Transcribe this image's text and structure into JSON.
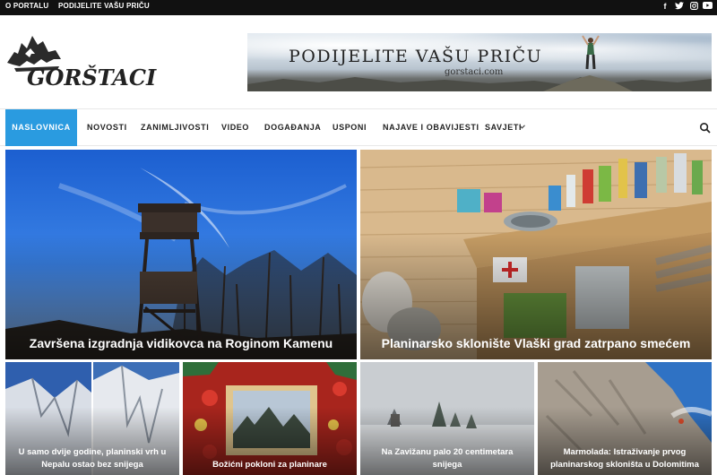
{
  "topbar": {
    "links": [
      "O PORTALU",
      "PODIJELITE VAŠU PRIČU"
    ],
    "social": [
      "f",
      "t",
      "ig",
      "yt"
    ]
  },
  "logo": {
    "text": "GORŠTACI"
  },
  "banner": {
    "title": "PODIJELITE VAŠU PRIČU",
    "subtitle": "gorstaci.com"
  },
  "nav": {
    "items": [
      "NASLOVNICA",
      "NOVOSTI",
      "ZANIMLJIVOSTI",
      "VIDEO",
      "DOGAĐANJA",
      "USPONI",
      "NAJAVE I OBAVIJESTI",
      "SAVJETI"
    ],
    "active_index": 0,
    "dropdown_icon": "chevron-down-icon",
    "search_icon": "search-icon"
  },
  "featured": [
    {
      "title": "Završena izgradnja vidikovca na Roginom Kamenu"
    },
    {
      "title": "Planinarsko sklonište Vlaški grad zatrpano smećem"
    }
  ],
  "articles": [
    {
      "title": "U samo dvije godine, planinski vrh u Nepalu ostao bez snijega"
    },
    {
      "title": "Božićni pokloni za planinare"
    },
    {
      "title": "Na Zavižanu palo 20 centimetara snijega"
    },
    {
      "title": "Marmolada: Istraživanje prvog planinarskog skloništa u Dolomitima"
    }
  ],
  "colors": {
    "accent": "#2a9be0",
    "topbar": "#111111"
  }
}
